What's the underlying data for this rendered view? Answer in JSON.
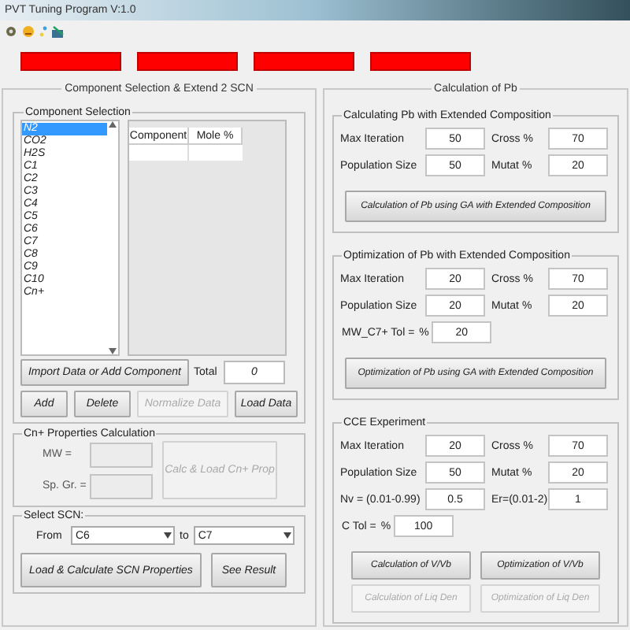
{
  "window": {
    "title": "PVT Tuning Program V:1.0"
  },
  "left": {
    "title": "Component Selection & Extend 2 SCN",
    "component_selection": {
      "title": "Component Selection",
      "list": [
        {
          "label": "N2",
          "selected": true
        },
        {
          "label": "CO2",
          "selected": false
        },
        {
          "label": "H2S",
          "selected": false
        },
        {
          "label": "C1",
          "selected": false
        },
        {
          "label": "C2",
          "selected": false
        },
        {
          "label": "C3",
          "selected": false
        },
        {
          "label": "C4",
          "selected": false
        },
        {
          "label": "C5",
          "selected": false
        },
        {
          "label": "C6",
          "selected": false
        },
        {
          "label": "C7",
          "selected": false
        },
        {
          "label": "C8",
          "selected": false
        },
        {
          "label": "C9",
          "selected": false
        },
        {
          "label": "C10",
          "selected": false
        },
        {
          "label": "Cn+",
          "selected": false
        }
      ],
      "table": {
        "columns": [
          "Component",
          "Mole %"
        ]
      },
      "import_button": "Import Data or Add Component",
      "total": {
        "label": "Total",
        "value": "0"
      },
      "buttons": [
        {
          "label": "Add",
          "disabled": false
        },
        {
          "label": "Delete",
          "disabled": false
        },
        {
          "label": "Normalize Data",
          "disabled": true
        },
        {
          "label": "Load Data",
          "disabled": false
        }
      ]
    },
    "cn_plus": {
      "title": "Cn+ Properties Calculation",
      "fields": [
        {
          "label": "MW =",
          "disabled": true
        },
        {
          "label": "Sp. Gr. =",
          "disabled": true
        }
      ],
      "button": {
        "label": "Calc & Load Cn+ Prop",
        "disabled": true
      }
    },
    "select_scn": {
      "title": "Select SCN:",
      "from_label": "From",
      "from": "C6",
      "to_label": "to",
      "to": "C7",
      "buttons": [
        "Load & Calculate SCN Properties",
        "See Result"
      ]
    }
  },
  "right": {
    "title": "Calculation of Pb",
    "groups": [
      {
        "title": "Calculating Pb with Extended Composition",
        "rows": [
          [
            {
              "label": "Max Iteration",
              "value": "50"
            },
            {
              "label": "Cross %",
              "value": "70"
            }
          ],
          [
            {
              "label": "Population Size",
              "value": "50"
            },
            {
              "label": "Mutat %",
              "value": "20"
            }
          ]
        ],
        "buttons": [
          [
            {
              "label": "Calculation of Pb using GA with Extended Composition",
              "disabled": false
            }
          ]
        ]
      },
      {
        "title": "Optimization of Pb with Extended Composition",
        "rows": [
          [
            {
              "label": "Max Iteration",
              "value": "20"
            },
            {
              "label": "Cross %",
              "value": "70"
            }
          ],
          [
            {
              "label": "Population Size",
              "value": "20"
            },
            {
              "label": "Mutat %",
              "value": "20"
            }
          ],
          [
            {
              "label": "MW_C7+ Tol =",
              "unit": "%",
              "value": "20"
            }
          ]
        ],
        "buttons": [
          [
            {
              "label": "Optimization of Pb using GA with Extended Composition",
              "disabled": false
            }
          ]
        ]
      },
      {
        "title": "CCE Experiment",
        "rows": [
          [
            {
              "label": "Max Iteration",
              "value": "20"
            },
            {
              "label": "Cross %",
              "value": "70"
            }
          ],
          [
            {
              "label": "Population Size",
              "value": "50"
            },
            {
              "label": "Mutat %",
              "value": "20"
            }
          ],
          [
            {
              "label": "Nv = (0.01-0.99)",
              "value": "0.5"
            },
            {
              "label": "Er=(0.01-2)",
              "value": "1"
            }
          ],
          [
            {
              "label": "C Tol =",
              "unit": "%",
              "value": "100"
            }
          ]
        ],
        "buttons": [
          [
            {
              "label": "Calculation of  V/Vb",
              "disabled": false
            },
            {
              "label": "Optimization of  V/Vb",
              "disabled": false
            }
          ],
          [
            {
              "label": "Calculation of Liq Den",
              "disabled": true
            },
            {
              "label": "Optimization of Liq Den",
              "disabled": true
            }
          ]
        ]
      }
    ]
  }
}
